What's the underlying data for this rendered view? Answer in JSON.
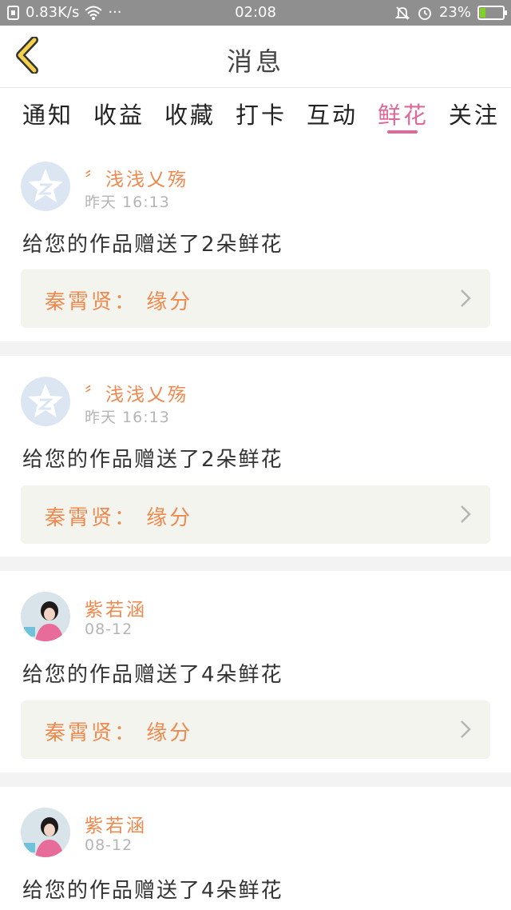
{
  "status_bar": {
    "network_speed": "0.83K/s",
    "more": "···",
    "time": "02:08",
    "battery_percent": "23%",
    "battery_level": 0.23,
    "icons": [
      "sim-icon",
      "wifi-icon",
      "mute-icon",
      "alarm-icon",
      "battery-icon"
    ]
  },
  "header": {
    "title": "消息",
    "back_icon": "chevron-left-icon",
    "accent_color": "#f5d04a"
  },
  "tabs": [
    {
      "label": "通知"
    },
    {
      "label": "收益"
    },
    {
      "label": "收藏"
    },
    {
      "label": "打卡"
    },
    {
      "label": "互动"
    },
    {
      "label": "鲜花",
      "active": true
    },
    {
      "label": "关注"
    }
  ],
  "colors": {
    "active_tab": "#e0699a",
    "username": "#ee8a4f",
    "work_box_bg": "#f4f4ee"
  },
  "messages": [
    {
      "username": "〞浅浅乂殇",
      "time": "昨天 16:13",
      "message": "给您的作品赠送了2朵鲜花",
      "work": "秦霄贤： 缘分",
      "avatar": "default-star-avatar"
    },
    {
      "username": "〞浅浅乂殇",
      "time": "昨天 16:13",
      "message": "给您的作品赠送了2朵鲜花",
      "work": "秦霄贤： 缘分",
      "avatar": "default-star-avatar"
    },
    {
      "username": "紫若涵",
      "time": "08-12",
      "message": "给您的作品赠送了4朵鲜花",
      "work": "秦霄贤： 缘分",
      "avatar": "photo-avatar"
    },
    {
      "username": "紫若涵",
      "time": "08-12",
      "message": "给您的作品赠送了4朵鲜花",
      "work": "",
      "avatar": "photo-avatar"
    }
  ]
}
